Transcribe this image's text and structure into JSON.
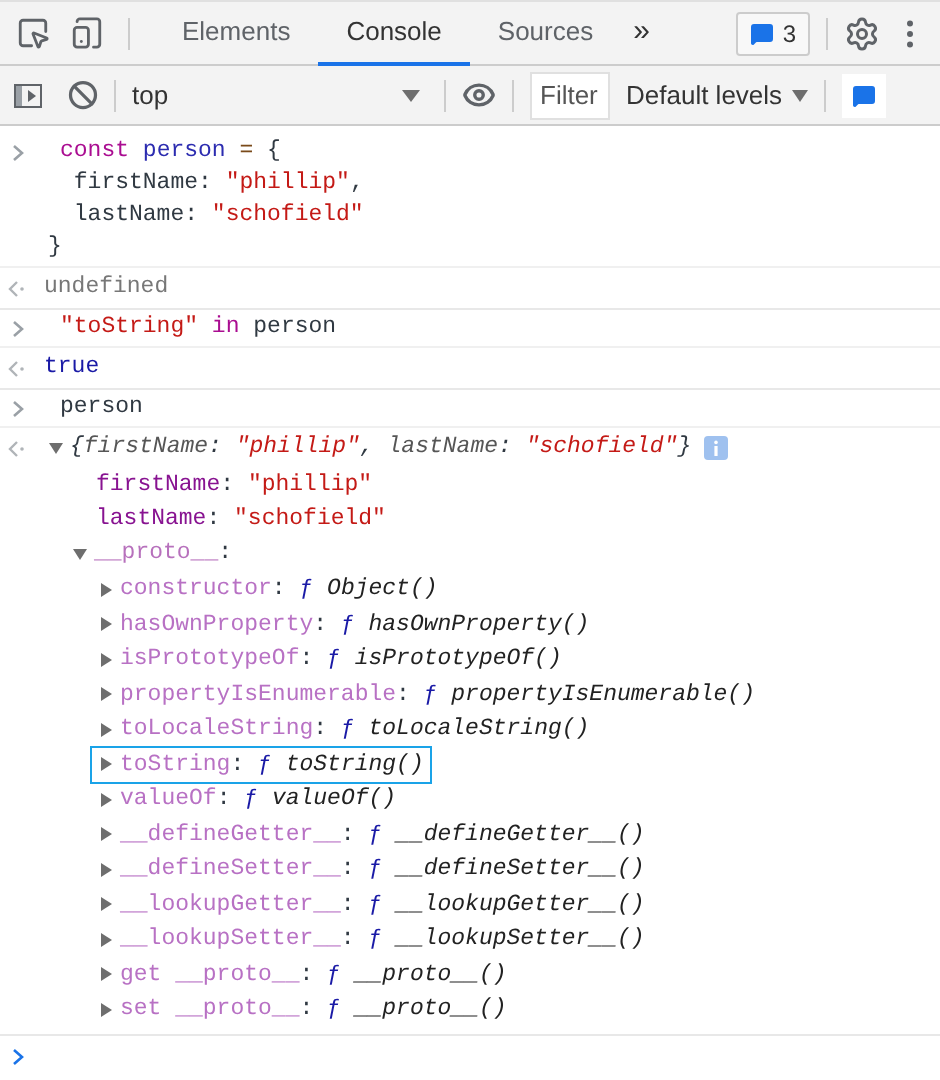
{
  "tabs": [
    {
      "label": "Elements",
      "selected": false
    },
    {
      "label": "Console",
      "selected": true
    },
    {
      "label": "Sources",
      "selected": false
    }
  ],
  "more_tabs": "»",
  "message_badge": {
    "count": "3"
  },
  "console_toolbar": {
    "context": "top",
    "filter": {
      "placeholder": "Filter"
    },
    "levels": "Default levels",
    "sidebar_open": false
  },
  "entries": [
    {
      "kind": "input",
      "lines": [
        [
          {
            "text": "const ",
            "kind": "keyword"
          },
          {
            "text": "person ",
            "kind": "variable"
          },
          {
            "text": "=",
            "kind": "operator"
          },
          {
            "text": " {",
            "kind": "plain"
          }
        ],
        [
          {
            "text": " firstName: ",
            "kind": "plain"
          },
          {
            "text": "\"phillip\"",
            "kind": "string"
          },
          {
            "text": ",",
            "kind": "plain"
          }
        ],
        [
          {
            "text": " lastName: ",
            "kind": "plain"
          },
          {
            "text": "\"schofield\"",
            "kind": "string"
          }
        ],
        [
          {
            "text": "}",
            "kind": "plain"
          }
        ]
      ]
    },
    {
      "kind": "result",
      "lines": [
        [
          {
            "text": "undefined",
            "kind": "muted"
          }
        ]
      ]
    },
    {
      "kind": "input",
      "lines": [
        [
          {
            "text": "\"toString\" ",
            "kind": "string"
          },
          {
            "text": "in",
            "kind": "keyword"
          },
          {
            "text": " person",
            "kind": "plain"
          }
        ]
      ]
    },
    {
      "kind": "result",
      "lines": [
        [
          {
            "text": "true",
            "kind": "boolean"
          }
        ]
      ]
    },
    {
      "kind": "input",
      "lines": [
        [
          {
            "text": "person",
            "kind": "plain"
          }
        ]
      ]
    },
    {
      "kind": "object",
      "expanded": true,
      "summary": [
        {
          "text": "{",
          "kind": "plain"
        },
        {
          "text": "firstName",
          "kind": "key"
        },
        {
          "text": ": ",
          "kind": "plain"
        },
        {
          "text": "\"phillip\"",
          "kind": "string"
        },
        {
          "text": ", ",
          "kind": "plain"
        },
        {
          "text": "lastName",
          "kind": "key"
        },
        {
          "text": ": ",
          "kind": "plain"
        },
        {
          "text": "\"schofield\"",
          "kind": "string"
        },
        {
          "text": "}",
          "kind": "plain"
        }
      ],
      "properties": [
        {
          "name": "firstName",
          "colon": ":",
          "value": "\"phillip\""
        },
        {
          "name": "lastName",
          "colon": ":",
          "value": "\"schofield\""
        }
      ],
      "proto": {
        "name": "__proto__",
        "colon": ":",
        "expanded": true,
        "children": [
          {
            "name": "constructor",
            "colon": ":",
            "mark": "ƒ",
            "signature": "Object()",
            "expanded": false,
            "focused": false
          },
          {
            "name": "hasOwnProperty",
            "colon": ":",
            "mark": "ƒ",
            "signature": "hasOwnProperty()",
            "expanded": false,
            "focused": false
          },
          {
            "name": "isPrototypeOf",
            "colon": ":",
            "mark": "ƒ",
            "signature": "isPrototypeOf()",
            "expanded": false,
            "focused": false
          },
          {
            "name": "propertyIsEnumerable",
            "colon": ":",
            "mark": "ƒ",
            "signature": "propertyIsEnumerable()",
            "expanded": false,
            "focused": false
          },
          {
            "name": "toLocaleString",
            "colon": ":",
            "mark": "ƒ",
            "signature": "toLocaleString()",
            "expanded": false,
            "focused": false
          },
          {
            "name": "toString",
            "colon": ":",
            "mark": "ƒ",
            "signature": "toString()",
            "expanded": false,
            "focused": true
          },
          {
            "name": "valueOf",
            "colon": ":",
            "mark": "ƒ",
            "signature": "valueOf()",
            "expanded": false,
            "focused": false
          },
          {
            "name": "__defineGetter__",
            "colon": ":",
            "mark": "ƒ",
            "signature": "__defineGetter__()",
            "expanded": false,
            "focused": false
          },
          {
            "name": "__defineSetter__",
            "colon": ":",
            "mark": "ƒ",
            "signature": "__defineSetter__()",
            "expanded": false,
            "focused": false
          },
          {
            "name": "__lookupGetter__",
            "colon": ":",
            "mark": "ƒ",
            "signature": "__lookupGetter__()",
            "expanded": false,
            "focused": false
          },
          {
            "name": "__lookupSetter__",
            "colon": ":",
            "mark": "ƒ",
            "signature": "__lookupSetter__()",
            "expanded": false,
            "focused": false
          },
          {
            "name": "get __proto__",
            "colon": ":",
            "mark": "ƒ",
            "signature": "__proto__()",
            "expanded": false,
            "focused": false
          },
          {
            "name": "set __proto__",
            "colon": ":",
            "mark": "ƒ",
            "signature": "__proto__()",
            "expanded": false,
            "focused": false
          }
        ]
      }
    }
  ]
}
